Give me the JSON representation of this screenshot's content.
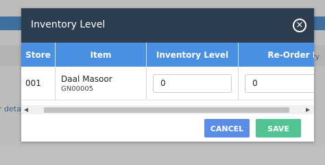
{
  "background": {
    "left_text": "r deta",
    "right_text": "ry"
  },
  "modal": {
    "title": "Inventory Level",
    "close_symbol": "×",
    "columns": [
      "Store",
      "Item",
      "Inventory Level",
      "Re-Order Level"
    ],
    "rows": [
      {
        "store": "001",
        "item_name": "Daal Masoor",
        "item_code": "GN00005",
        "inventory_level": "0",
        "reorder_level": "0"
      }
    ],
    "scroll_left": "◀",
    "scroll_right": "▶",
    "cancel_label": "CANCEL",
    "save_label": "SAVE"
  },
  "colors": {
    "header_bg": "#2c3e50",
    "table_header_bg": "#4a90e2",
    "cancel_bg": "#5b8de8",
    "save_bg": "#52c494"
  },
  "icons": {
    "close": "close-circle-icon",
    "scroll_left": "triangle-left-icon",
    "scroll_right": "triangle-right-icon"
  }
}
